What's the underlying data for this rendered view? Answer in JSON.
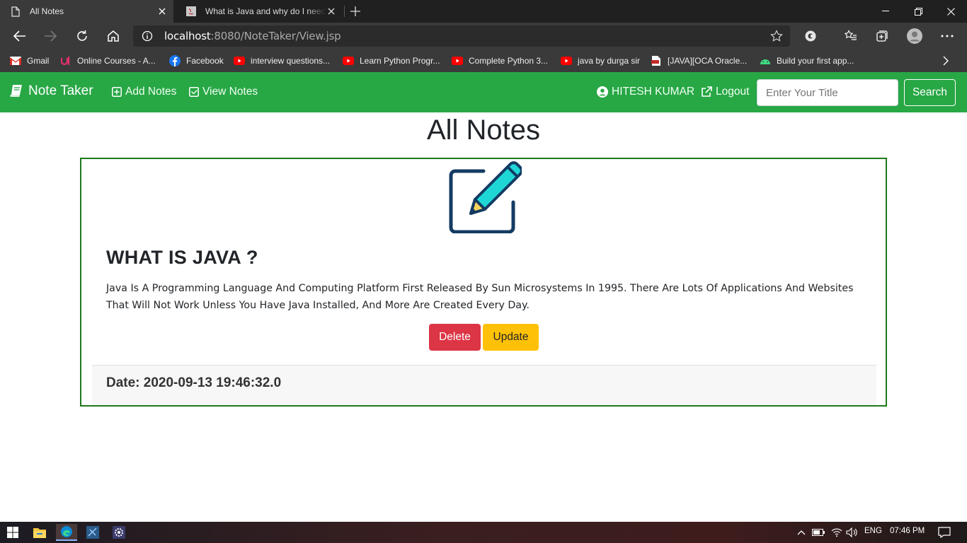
{
  "browser": {
    "tabs": [
      {
        "title": "All Notes",
        "active": true
      },
      {
        "title": "What is Java and why do I need it?",
        "active": false
      }
    ],
    "url_host": "localhost",
    "url_rest": ":8080/NoteTaker/View.jsp",
    "bookmarks": [
      {
        "label": "Gmail",
        "icon": "gmail-icon"
      },
      {
        "label": "Online Courses - A...",
        "icon": "udemy-icon"
      },
      {
        "label": "Facebook",
        "icon": "facebook-icon"
      },
      {
        "label": "interview questions...",
        "icon": "youtube-icon"
      },
      {
        "label": "Learn Python Progr...",
        "icon": "youtube-icon"
      },
      {
        "label": "Complete Python 3...",
        "icon": "youtube-icon"
      },
      {
        "label": "java by durga sir",
        "icon": "youtube-icon"
      },
      {
        "label": "[JAVA][OCA Oracle...",
        "icon": "pdf-icon"
      },
      {
        "label": "Build your first app...",
        "icon": "android-icon"
      }
    ]
  },
  "navbar": {
    "brand": "Note Taker",
    "add_notes": "Add Notes",
    "view_notes": "View Notes",
    "user": "HITESH KUMAR",
    "logout": "Logout",
    "search_placeholder": "Enter Your Title",
    "search_button": "Search",
    "color": "#28a745"
  },
  "main": {
    "page_title": "All Notes",
    "notes": [
      {
        "title": "WHAT IS JAVA ?",
        "content": "Java Is A Programming Language And Computing Platform First Released By Sun Microsystems In 1995. There Are Lots Of Applications And Websites That Will Not Work Unless You Have Java Installed, And More Are Created Every Day.",
        "delete_label": "Delete",
        "update_label": "Update",
        "date": "Date: 2020-09-13 19:46:32.0"
      }
    ]
  },
  "taskbar": {
    "language": "ENG",
    "time": "07:46 PM"
  }
}
